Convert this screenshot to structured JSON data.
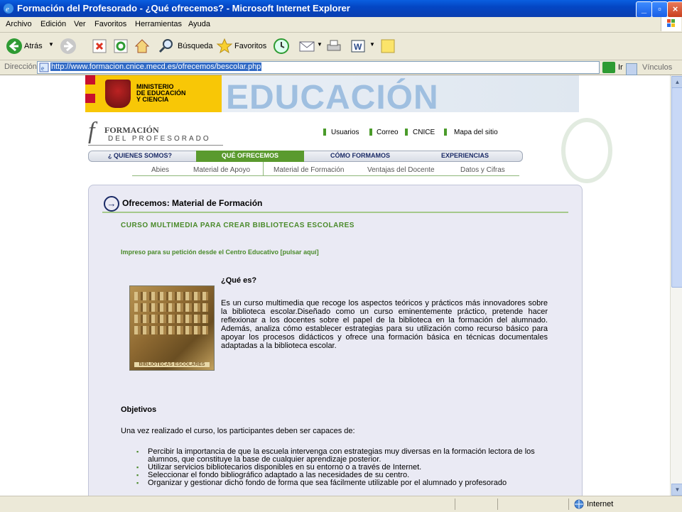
{
  "window": {
    "title": "Formación del Profesorado - ¿Qué ofrecemos? - Microsoft Internet Explorer",
    "controls": {
      "minimize": "_",
      "maximize": "▫",
      "close": "×"
    }
  },
  "menu": [
    "Archivo",
    "Edición",
    "Ver",
    "Favoritos",
    "Herramientas",
    "Ayuda"
  ],
  "toolbar": {
    "back": "Atrás",
    "search": "Búsqueda",
    "favorites": "Favoritos"
  },
  "address": {
    "label": "Dirección",
    "url": "http://www.formacion.cnice.mecd.es/ofrecemos/bescolar.php",
    "go": "Ir",
    "links": "Vínculos"
  },
  "status": {
    "zone": "Internet"
  },
  "header": {
    "ministry": [
      "MINISTERIO",
      "DE EDUCACIÓN",
      "Y CIENCIA"
    ],
    "banner": "EDUCACIÓN",
    "logo_letter": "f",
    "logo_line1": "FORMACIÓN",
    "logo_line2": "DEL PROFESORADO",
    "toplinks": [
      "Usuarios",
      "Correo",
      "CNICE",
      "Mapa del sitio"
    ]
  },
  "nav": {
    "items": [
      "¿ QUIENES SOMOS?",
      "QUÉ OFRECEMOS",
      "CÓMO FORMAMOS",
      "EXPERIENCIAS"
    ],
    "selected": 1,
    "sub": [
      "Abies",
      "Material de Apoyo",
      "Material de Formación",
      "Ventajas del Docente",
      "Datos y Cifras"
    ]
  },
  "content": {
    "title": "Ofrecemos: Material de Formación",
    "course_title": "CURSO MULTIMEDIA PARA CREAR BIBLIOTECAS ESCOLARES",
    "print_note": "Impreso para su petición desde el Centro Educativo [pulsar aquí]",
    "image_label": "BIBLIOTECAS ESCOLARES",
    "what_title": "¿Qué es?",
    "what_text": "Es un curso multimedia que recoge los aspectos teóricos y prácticos más innovadores sobre la biblioteca escolar.Diseñado como un curso eminentemente práctico, pretende hacer reflexionar a los docentes sobre el papel de la biblioteca en la formación del alumnado. Además, analiza cómo establecer estrategias para su utilización como recurso básico para apoyar los procesos didácticos y ofrece una formación básica en técnicas documentales adaptadas a la biblioteca escolar.",
    "objectives_title": "Objetivos",
    "objectives_intro": "Una vez realizado el curso, los participantes deben ser capaces de:",
    "objectives": [
      "Percibir la importancia de que la escuela intervenga con estrategias muy diversas en la formación lectora de los alumnos, que constituye la base de cualquier aprendizaje posterior.",
      "Utilizar servicios bibliotecarios disponibles en su entorno o a través de Internet.",
      "Seleccionar el fondo bibliográfico adaptado a las necesidades de su centro.",
      "Organizar y gestionar dicho fondo de forma que sea fácilmente utilizable por el alumnado y profesorado"
    ]
  }
}
